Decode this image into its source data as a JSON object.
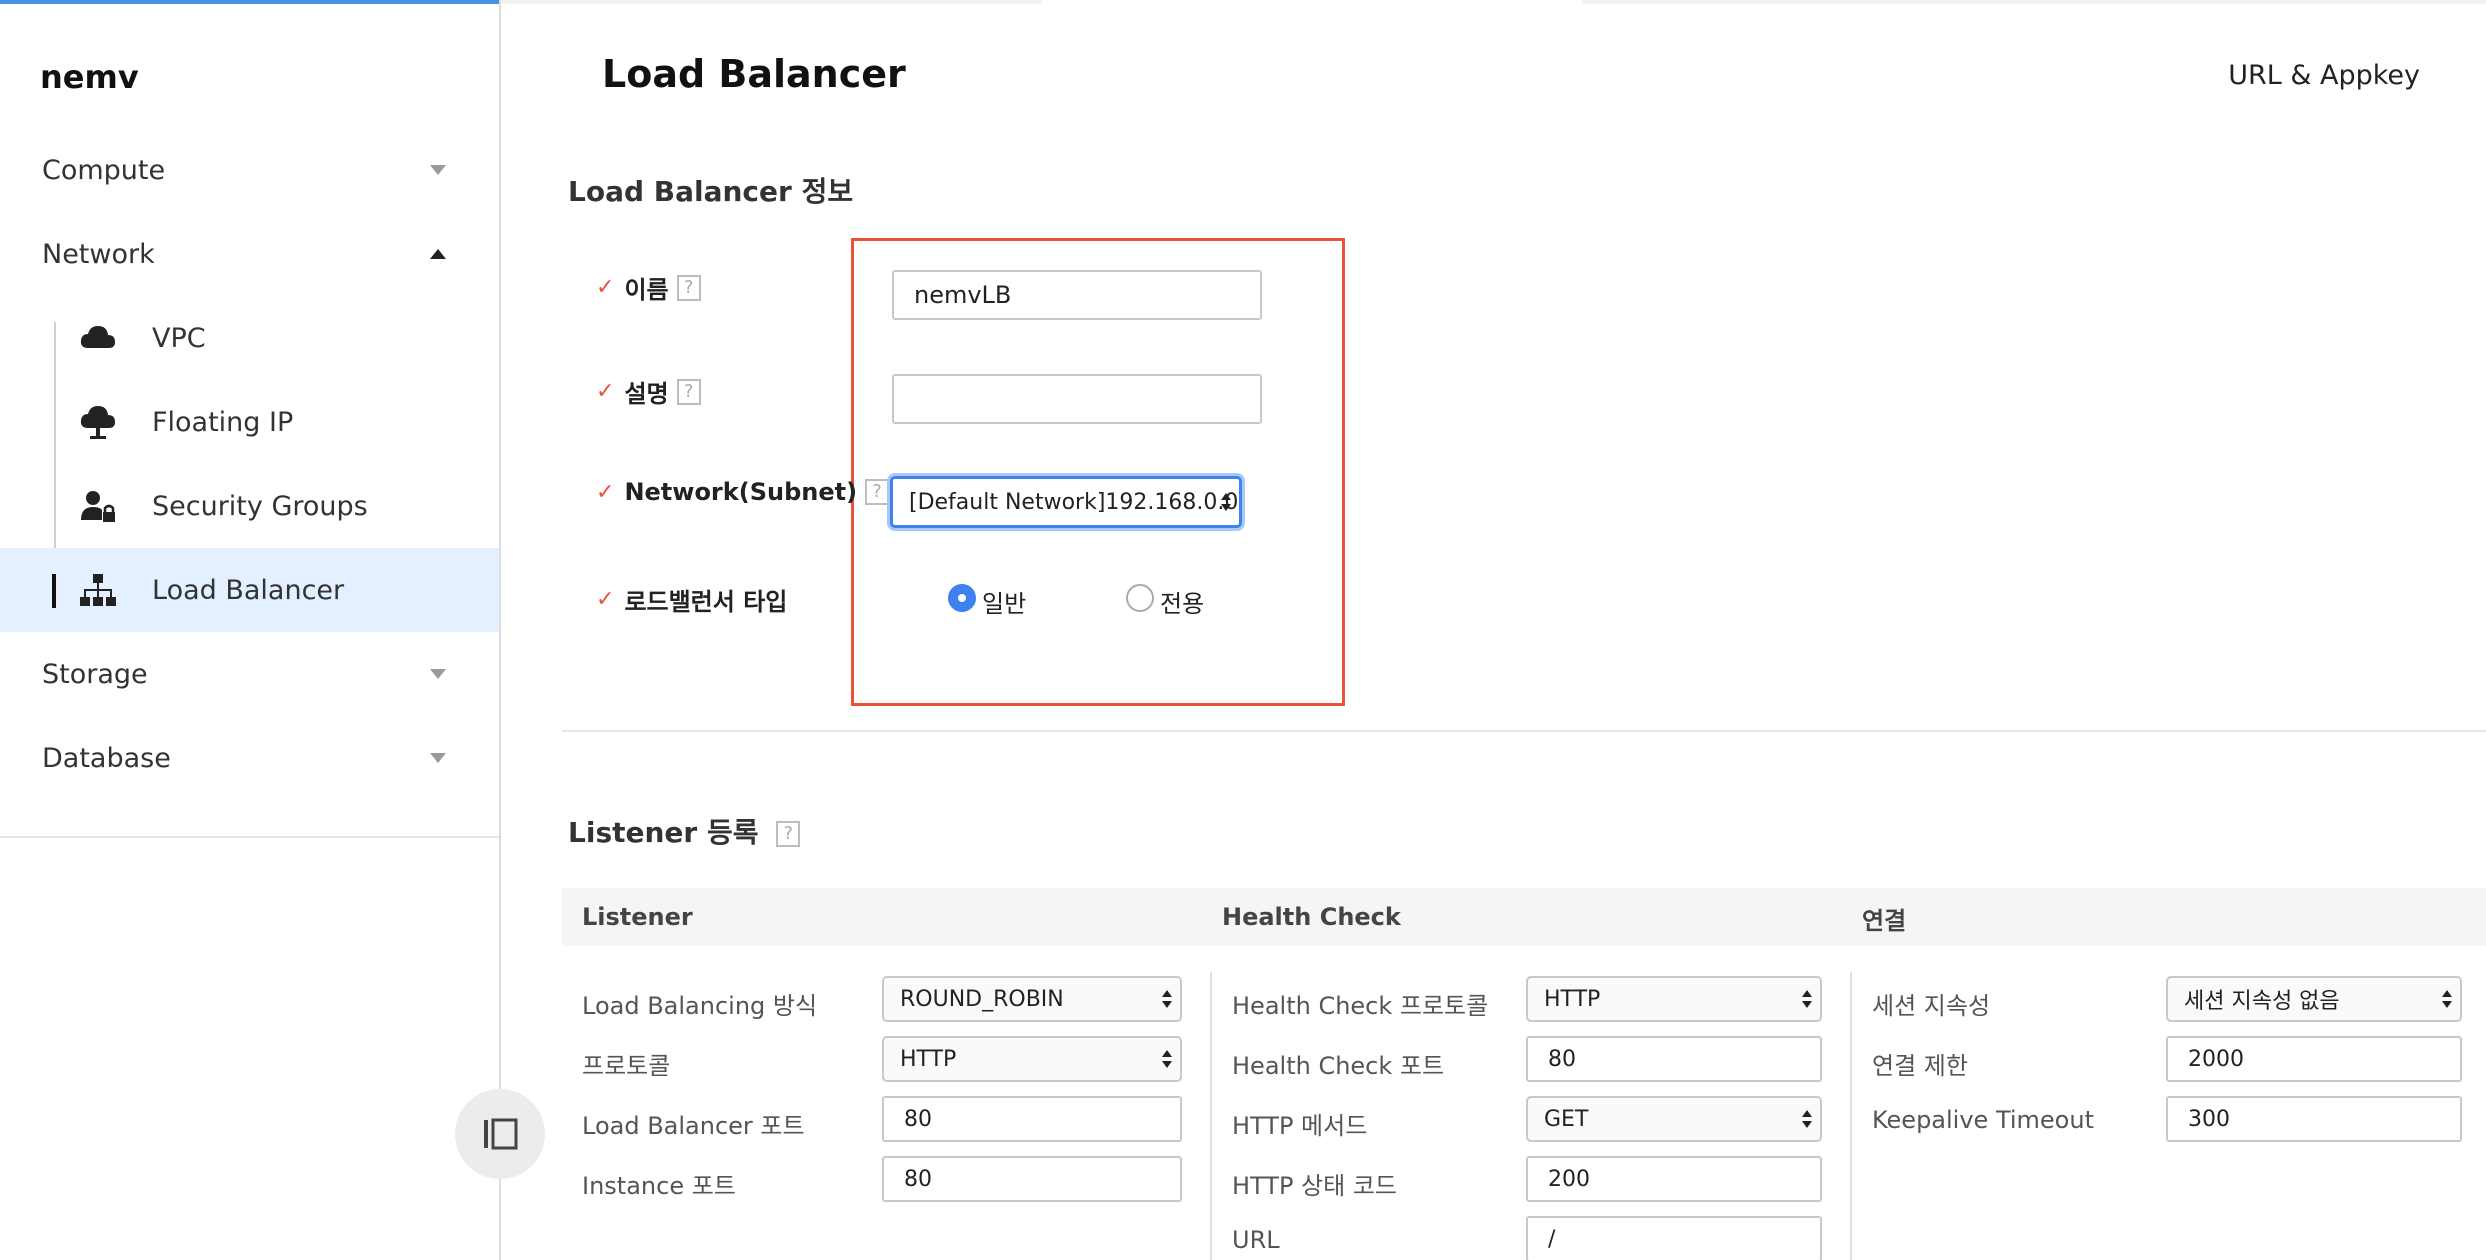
{
  "sidebar": {
    "brand": "nemv",
    "menus": [
      {
        "label": "Compute",
        "icon": "chevron-down-icon"
      },
      {
        "label": "Network",
        "icon": "chevron-up-icon"
      },
      {
        "label": "Storage",
        "icon": "chevron-down-icon"
      },
      {
        "label": "Database",
        "icon": "chevron-down-icon"
      }
    ],
    "network_items": [
      {
        "label": "VPC",
        "icon": "cloud-icon"
      },
      {
        "label": "Floating IP",
        "icon": "cloud-upload-icon"
      },
      {
        "label": "Security Groups",
        "icon": "user-lock-icon"
      },
      {
        "label": "Load Balancer",
        "icon": "sitemap-icon",
        "active": true
      }
    ]
  },
  "header": {
    "title": "Load Balancer",
    "url_appkey": "URL & Appkey"
  },
  "lb_info": {
    "section_title": "Load Balancer 정보",
    "help": "?",
    "check": "✓",
    "name_label": "이름",
    "name_value": "nemvLB",
    "desc_label": "설명",
    "desc_value": "",
    "network_label": "Network(Subnet)",
    "network_value": "[Default Network]192.168.0.0",
    "type_label": "로드밸런서 타입",
    "type_options": [
      {
        "label": "일반",
        "selected": true
      },
      {
        "label": "전용",
        "selected": false
      }
    ]
  },
  "listener": {
    "section_title": "Listener 등록",
    "columns": [
      "Listener",
      "Health Check",
      "연결"
    ],
    "listener_fields": [
      {
        "label": "Load Balancing 방식",
        "value": "ROUND_ROBIN",
        "kind": "select"
      },
      {
        "label": "프로토콜",
        "value": "HTTP",
        "kind": "select"
      },
      {
        "label": "Load Balancer 포트",
        "value": "80",
        "kind": "input"
      },
      {
        "label": "Instance 포트",
        "value": "80",
        "kind": "input"
      }
    ],
    "health_fields": [
      {
        "label": "Health Check 프로토콜",
        "value": "HTTP",
        "kind": "select"
      },
      {
        "label": "Health Check 포트",
        "value": "80",
        "kind": "input"
      },
      {
        "label": "HTTP 메서드",
        "value": "GET",
        "kind": "select"
      },
      {
        "label": "HTTP 상태 코드",
        "value": "200",
        "kind": "input"
      },
      {
        "label": "URL",
        "value": "/",
        "kind": "input"
      }
    ],
    "connection_fields": [
      {
        "label": "세션 지속성",
        "value": "세션 지속성 없음",
        "kind": "select"
      },
      {
        "label": "연결 제한",
        "value": "2000",
        "kind": "input"
      },
      {
        "label": "Keepalive Timeout",
        "value": "300",
        "kind": "input"
      }
    ]
  },
  "colors": {
    "accent": "#3d82ef",
    "required_check": "#e8543a",
    "highlight_box": "#e8543a",
    "active_nav_bg": "#e4efff"
  }
}
